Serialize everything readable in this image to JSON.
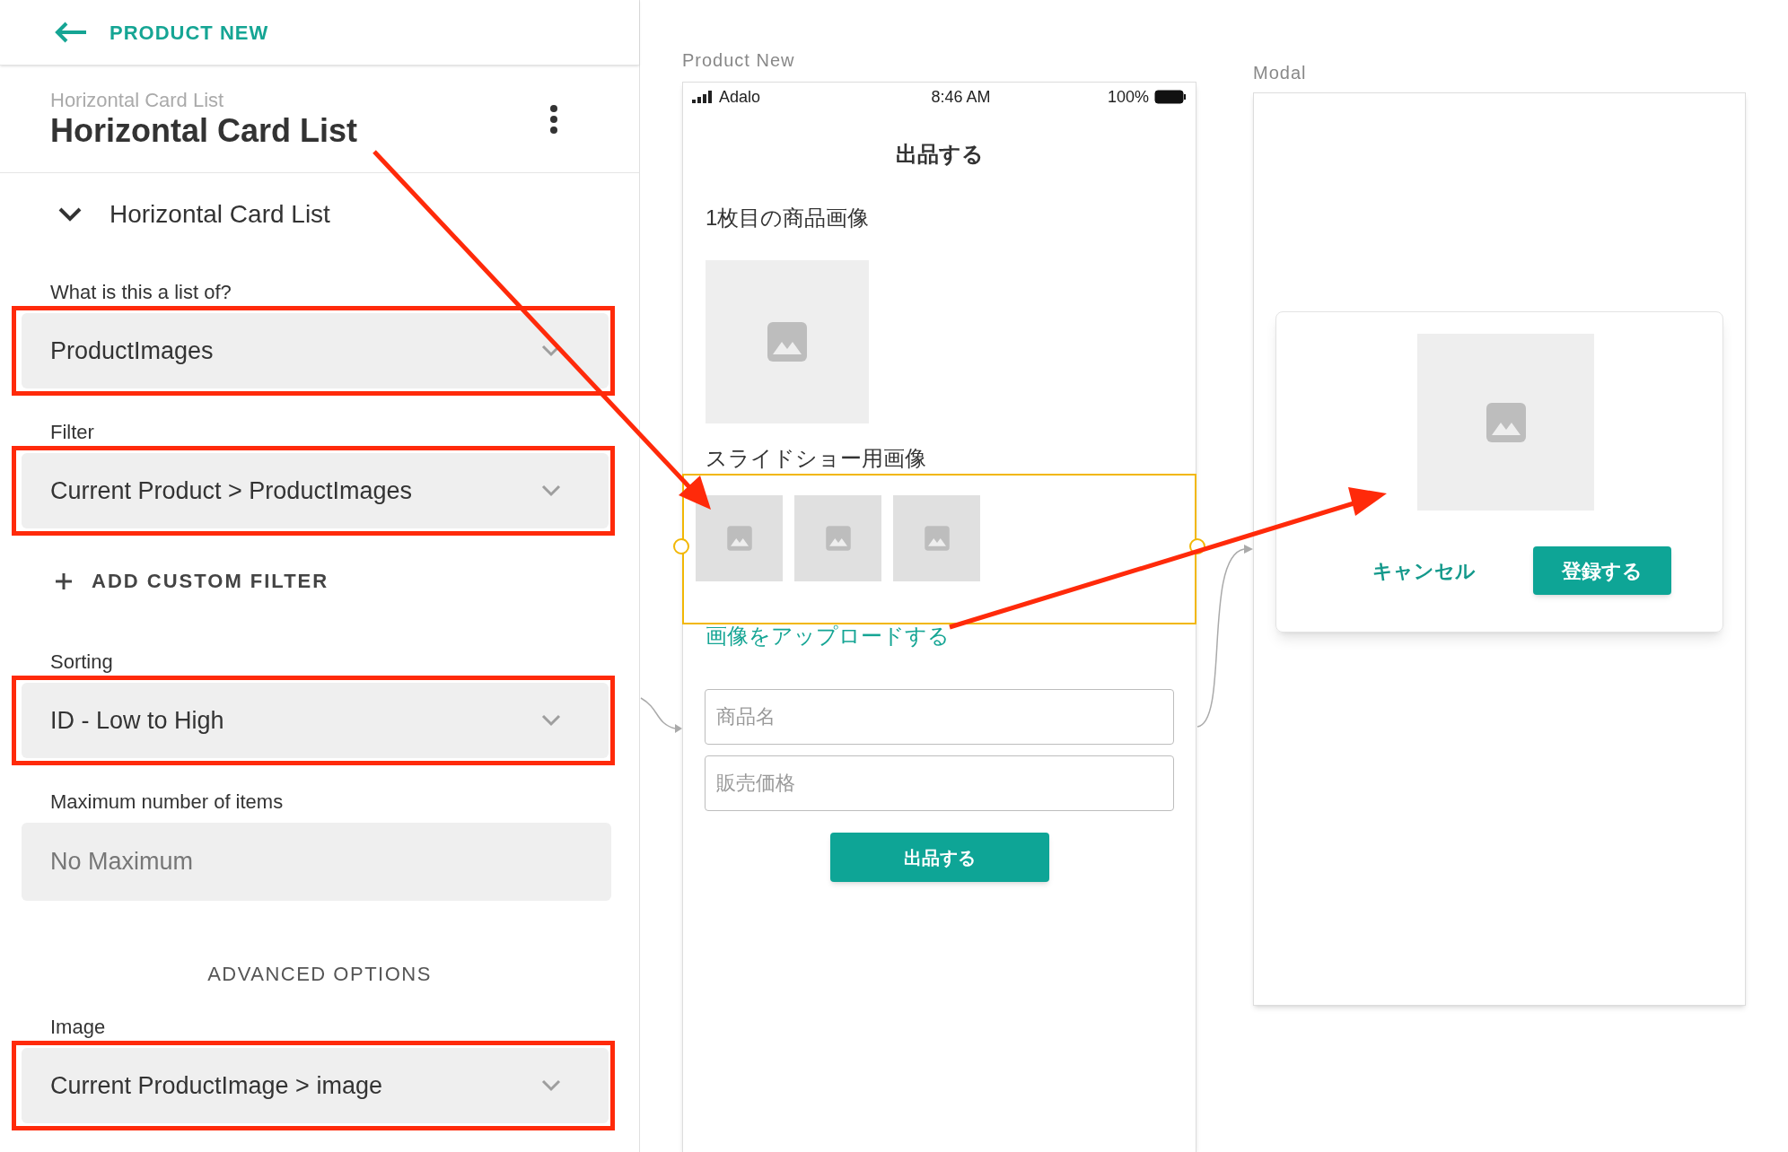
{
  "header": {
    "back_label": "PRODUCT NEW"
  },
  "component": {
    "subtitle": "Horizontal Card List",
    "title": "Horizontal Card List"
  },
  "section": {
    "title": "Horizontal Card List",
    "expanded": true
  },
  "fields": [
    {
      "kind": "dropdown",
      "label": "What is this a list of?",
      "value": "ProductImages",
      "highlighted": true
    },
    {
      "kind": "dropdown",
      "label": "Filter",
      "value": "Current Product > ProductImages",
      "highlighted": true
    },
    {
      "kind": "action",
      "label": "ADD CUSTOM FILTER"
    },
    {
      "kind": "dropdown",
      "label": "Sorting",
      "value": "ID - Low to High",
      "highlighted": true
    },
    {
      "kind": "input",
      "label": "Maximum number of items",
      "placeholder": "No Maximum"
    },
    {
      "kind": "heading",
      "label": "ADVANCED OPTIONS"
    },
    {
      "kind": "dropdown",
      "label": "Image",
      "value": "Current ProductImage > image",
      "highlighted": true
    }
  ],
  "phone": {
    "label": "Product New",
    "carrier": "Adalo",
    "time": "8:46 AM",
    "battery": "100%",
    "title": "出品する",
    "image_label": "1枚目の商品画像",
    "slideshow_label": "スライドショー用画像",
    "list_selected": true,
    "cards": [
      {
        "kind": "image"
      },
      {
        "kind": "image"
      },
      {
        "kind": "image"
      }
    ],
    "upload_link": "画像をアップロードする",
    "inputs": [
      {
        "placeholder": "商品名"
      },
      {
        "placeholder": "販売価格"
      }
    ],
    "button": "出品する"
  },
  "modal": {
    "label": "Modal",
    "cancel": "キャンセル",
    "submit": "登録する"
  }
}
